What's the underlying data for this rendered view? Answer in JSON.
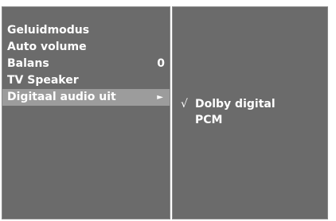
{
  "menu": {
    "items": [
      {
        "label": "Geluidmodus",
        "value": "",
        "arrow": ""
      },
      {
        "label": "Auto volume",
        "value": "",
        "arrow": ""
      },
      {
        "label": "Balans",
        "value": "0",
        "arrow": ""
      },
      {
        "label": "TV Speaker",
        "value": "",
        "arrow": ""
      },
      {
        "label": "Digitaal audio uit",
        "value": "",
        "arrow": "►"
      }
    ],
    "selected_index": 4
  },
  "submenu": {
    "items": [
      {
        "check": "√",
        "label": "Dolby digital",
        "checked": true
      },
      {
        "check": "",
        "label": "PCM",
        "checked": false
      }
    ]
  },
  "colors": {
    "panel": "#6b6b6b",
    "highlight": "#9c9c9c",
    "text": "#ffffff"
  }
}
